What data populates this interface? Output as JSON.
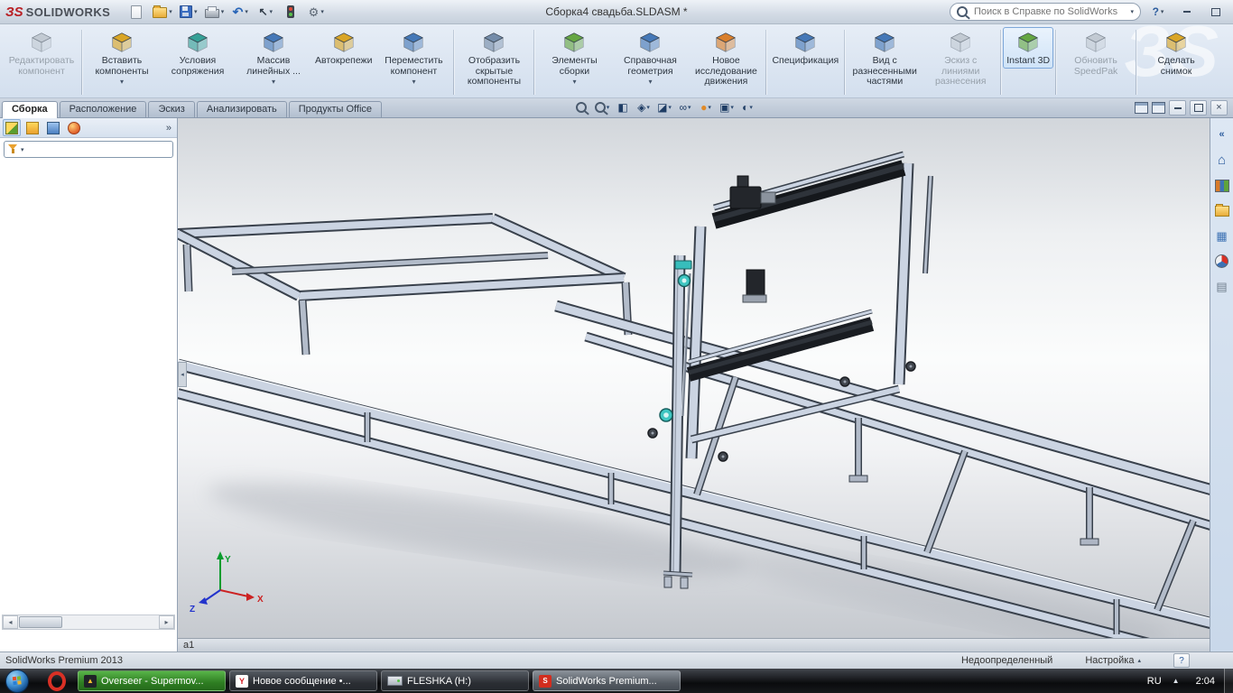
{
  "titlebar": {
    "logo": "ЗS",
    "brand": "SOLIDWORKS",
    "document_title": "Сборка4 свадьба.SLDASM *",
    "search_placeholder": "Поиск в Справке по SolidWorks",
    "help_label": "?"
  },
  "ribbon": {
    "watermark": "ЗS",
    "buttons": [
      {
        "label": "Редактировать компонент"
      },
      {
        "label": "Вставить компоненты"
      },
      {
        "label": "Условия сопряжения"
      },
      {
        "label": "Массив линейных ..."
      },
      {
        "label": "Автокрепежи"
      },
      {
        "label": "Переместить компонент"
      },
      {
        "label": "Отобразить скрытые компоненты"
      },
      {
        "label": "Элементы сборки"
      },
      {
        "label": "Справочная геометрия"
      },
      {
        "label": "Новое исследование движения"
      },
      {
        "label": "Спецификация"
      },
      {
        "label": "Вид с разнесенными частями"
      },
      {
        "label": "Эскиз с линиями разнесения"
      },
      {
        "label": "Instant 3D"
      },
      {
        "label": "Обновить SpeedPak"
      },
      {
        "label": "Сделать снимок"
      }
    ]
  },
  "tabs": {
    "items": [
      {
        "label": "Сборка"
      },
      {
        "label": "Расположение"
      },
      {
        "label": "Эскиз"
      },
      {
        "label": "Анализировать"
      },
      {
        "label": "Продукты Office"
      }
    ]
  },
  "viewport": {
    "doc_bar_label": "а1",
    "triad_x": "X",
    "triad_y": "Y",
    "triad_z": "Z"
  },
  "statusbar": {
    "product": "SolidWorks Premium 2013",
    "state": "Недоопределенный",
    "settings_label": "Настройка",
    "help_label": "?"
  },
  "taskbar": {
    "items": [
      {
        "label": "Overseer - Supermov..."
      },
      {
        "label": "Новое сообщение •..."
      },
      {
        "label": "FLESHKA (H:)"
      },
      {
        "label": "SolidWorks Premium..."
      }
    ],
    "language": "RU",
    "time": "2:04"
  }
}
